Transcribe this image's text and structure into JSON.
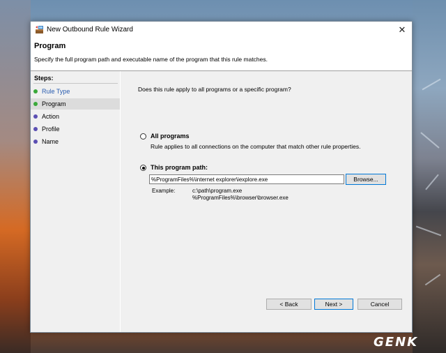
{
  "window": {
    "title": "New Outbound Rule Wizard",
    "close_glyph": "✕"
  },
  "header": {
    "title": "Program",
    "subtitle": "Specify the full program path and executable name of the program that this rule matches."
  },
  "steps": {
    "heading": "Steps:",
    "items": [
      {
        "label": "Rule Type",
        "status": "completed",
        "color": "#3aa93a",
        "text_color": "#2a5db0"
      },
      {
        "label": "Program",
        "status": "current",
        "color": "#3aa93a",
        "text_color": "#000000"
      },
      {
        "label": "Action",
        "status": "pending",
        "color": "#5b4fb3",
        "text_color": "#000000"
      },
      {
        "label": "Profile",
        "status": "pending",
        "color": "#5b4fb3",
        "text_color": "#000000"
      },
      {
        "label": "Name",
        "status": "pending",
        "color": "#5b4fb3",
        "text_color": "#000000"
      }
    ]
  },
  "content": {
    "question": "Does this rule apply to all programs or a specific program?",
    "all_programs": {
      "label": "All programs",
      "description": "Rule applies to all connections on the computer that match other rule properties.",
      "selected": false
    },
    "program_path": {
      "label": "This program path:",
      "value": "%ProgramFiles%\\internet explorer\\iexplore.exe",
      "selected": true
    },
    "browse_label": "Browse...",
    "example_label": "Example:",
    "example_lines": [
      "c:\\path\\program.exe",
      "%ProgramFiles%\\browser\\browser.exe"
    ]
  },
  "footer": {
    "back_label": "< Back",
    "next_label": "Next >",
    "cancel_label": "Cancel"
  },
  "watermark": "GENK",
  "colors": {
    "accent": "#0078d7",
    "panel_bg": "#f0f0f0"
  }
}
